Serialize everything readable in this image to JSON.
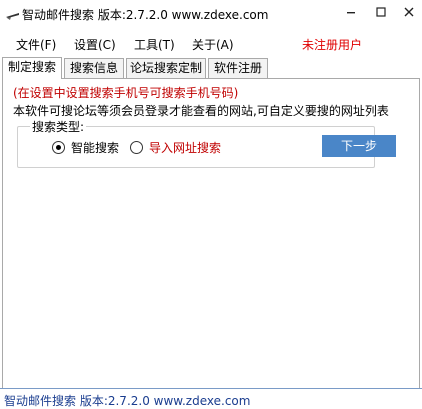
{
  "window": {
    "title": "智动邮件搜索 版本:2.7.2.0 www.zdexe.com",
    "icon": "app-icon",
    "controls": {
      "minimize": "minimize-icon",
      "maximize": "maximize-icon",
      "close": "close-icon"
    }
  },
  "menu": {
    "items": [
      {
        "label": "文件(F)"
      },
      {
        "label": "设置(C)"
      },
      {
        "label": "工具(T)"
      },
      {
        "label": "关于(A)"
      }
    ],
    "registration_status": "未注册用户"
  },
  "tabs": [
    {
      "label": "制定搜索",
      "active": true
    },
    {
      "label": "搜索信息",
      "active": false
    },
    {
      "label": "论坛搜索定制",
      "active": false
    },
    {
      "label": "软件注册",
      "active": false
    }
  ],
  "panel": {
    "hint": "(在设置中设置搜索手机号可搜索手机号码)",
    "description": "本软件可搜论坛等须会员登录才能查看的网站,可自定义要搜的网址列表",
    "search_type_label": "搜索类型:",
    "options": [
      {
        "label": "智能搜索",
        "checked": true
      },
      {
        "label": "导入网址搜索",
        "checked": false
      }
    ],
    "next_button": "下一步"
  },
  "status_bar": {
    "text": "智动邮件搜索 版本:2.7.2.0 www.zdexe.com"
  },
  "colors": {
    "accent_button": "#4a86c8",
    "warning_red": "#c00000",
    "unregistered_red": "#e00000",
    "status_text": "#1a3d8f"
  }
}
